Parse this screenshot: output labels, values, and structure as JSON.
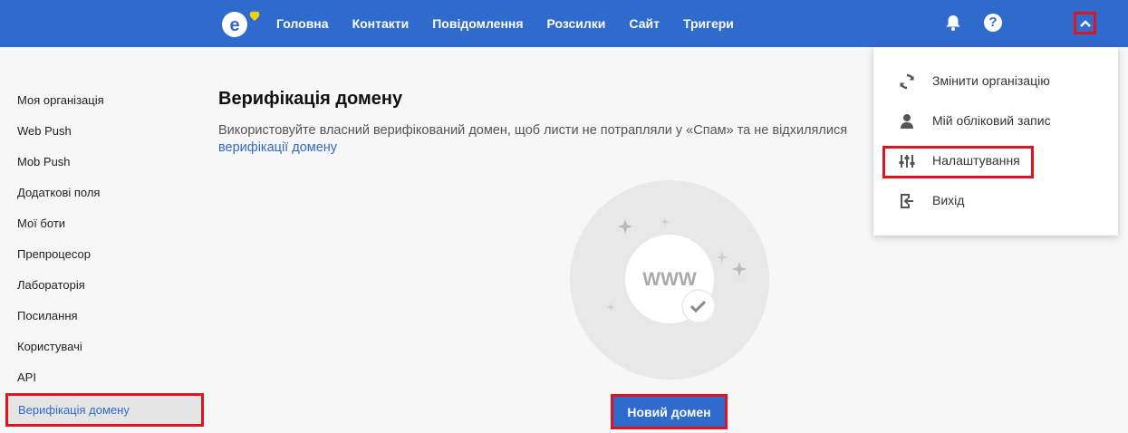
{
  "topbar": {
    "nav": [
      "Головна",
      "Контакти",
      "Повідомлення",
      "Розсилки",
      "Сайт",
      "Тригери"
    ],
    "icons": {
      "notifications": "bell-icon",
      "help": "question-icon",
      "user_menu": "chevron-up-icon"
    },
    "help_glyph": "?"
  },
  "sidebar": {
    "items": [
      "Моя організація",
      "Web Push",
      "Mob Push",
      "Додаткові поля",
      "Мої боти",
      "Препроцесор",
      "Лабораторія",
      "Посилання",
      "Користувачі",
      "API",
      "Верифікація домену"
    ],
    "active_index": 10
  },
  "main": {
    "title": "Верифікація домену",
    "description": "Використовуйте власний верифікований домен, щоб листи не потрапляли у «Спам» та не відхилялися",
    "link": "верифікації домену",
    "illustration_text": "WWW",
    "new_domain_button": "Новий домен"
  },
  "dropdown": {
    "items": [
      {
        "label": "Змінити організацію",
        "icon": "sync-icon"
      },
      {
        "label": "Мій обліковий запис",
        "icon": "person-icon"
      },
      {
        "label": "Налаштування",
        "icon": "sliders-icon"
      },
      {
        "label": "Вихід",
        "icon": "logout-icon"
      }
    ]
  },
  "colors": {
    "primary": "#2f6acd",
    "highlight": "#e0141e",
    "background": "#f7f7f7"
  }
}
